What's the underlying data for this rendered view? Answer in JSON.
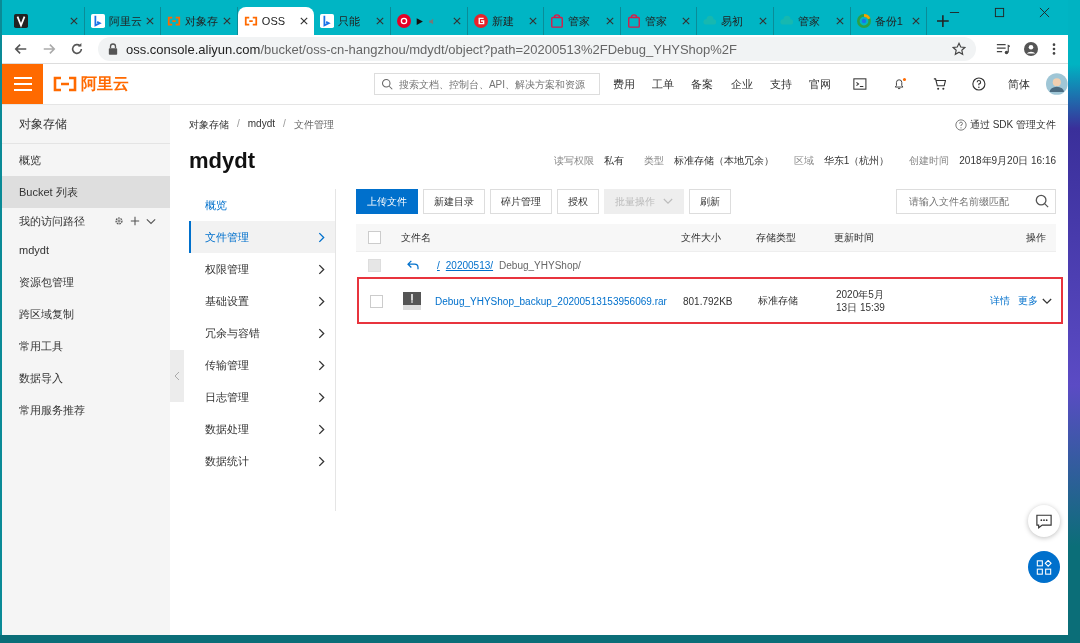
{
  "browser": {
    "tabs": [
      {
        "selected": false
      },
      {
        "title": "阿里云",
        "selected": false
      },
      {
        "title": "对象存",
        "selected": false
      },
      {
        "title": "OSS",
        "selected": true
      },
      {
        "title": "只能",
        "selected": false
      },
      {
        "selected": false
      },
      {
        "title": "新建",
        "selected": false
      },
      {
        "title": "管家",
        "selected": false
      },
      {
        "title": "管家",
        "selected": false
      },
      {
        "title": "易初",
        "selected": false
      },
      {
        "title": "管家",
        "selected": false
      },
      {
        "title": "备份1",
        "selected": false
      }
    ],
    "url": {
      "host": "oss.console.aliyun.com",
      "path": "/bucket/oss-cn-hangzhou/mdydt/object?path=20200513%2FDebug_YHYShop%2F"
    }
  },
  "topnav": {
    "brand": "阿里云",
    "search": {
      "placeholder": "搜索文档、控制台、API、解决方案和资源"
    },
    "links": [
      "费用",
      "工单",
      "备案",
      "企业",
      "支持",
      "官网"
    ],
    "has_notification": true,
    "language": "简体"
  },
  "sidebar": {
    "title": "对象存储",
    "items": [
      {
        "kind": "item",
        "label": "概览",
        "selected": false
      },
      {
        "kind": "item",
        "label": "Bucket 列表",
        "selected": true
      },
      {
        "kind": "section",
        "label": "我的访问路径"
      },
      {
        "kind": "item",
        "label": "mdydt",
        "selected": false
      },
      {
        "kind": "item",
        "label": "资源包管理",
        "selected": false
      },
      {
        "kind": "item",
        "label": "跨区域复制",
        "selected": false
      },
      {
        "kind": "item",
        "label": "常用工具",
        "selected": false
      },
      {
        "kind": "item",
        "label": "数据导入",
        "selected": false
      },
      {
        "kind": "item",
        "label": "常用服务推荐",
        "selected": false
      }
    ]
  },
  "breadcrumb": {
    "items": [
      "对象存储",
      "mdydt",
      "文件管理"
    ],
    "separator": "/"
  },
  "sdk_link": "通过 SDK 管理文件",
  "bucket": {
    "name": "mdydt",
    "meta": [
      {
        "label": "读写权限",
        "value": "私有"
      },
      {
        "label": "类型",
        "value": "标准存储（本地冗余）"
      },
      {
        "label": "区域",
        "value": "华东1（杭州）"
      },
      {
        "label": "创建时间",
        "value": "2018年9月20日 16:16"
      }
    ]
  },
  "subnav": [
    {
      "label": "概览",
      "expandable": false,
      "selected": false
    },
    {
      "label": "文件管理",
      "expandable": true,
      "selected": true
    },
    {
      "label": "权限管理",
      "expandable": true,
      "selected": false
    },
    {
      "label": "基础设置",
      "expandable": true,
      "selected": false
    },
    {
      "label": "冗余与容错",
      "expandable": true,
      "selected": false
    },
    {
      "label": "传输管理",
      "expandable": true,
      "selected": false
    },
    {
      "label": "日志管理",
      "expandable": true,
      "selected": false
    },
    {
      "label": "数据处理",
      "expandable": true,
      "selected": false
    },
    {
      "label": "数据统计",
      "expandable": true,
      "selected": false
    }
  ],
  "toolbar": {
    "buttons": [
      {
        "label": "上传文件",
        "kind": "primary",
        "disabled": false
      },
      {
        "label": "新建目录",
        "kind": "normal",
        "disabled": false
      },
      {
        "label": "碎片管理",
        "kind": "normal",
        "disabled": false
      },
      {
        "label": "授权",
        "kind": "normal",
        "disabled": false
      },
      {
        "label": "批量操作",
        "kind": "dropdown",
        "disabled": true
      },
      {
        "label": "刷新",
        "kind": "normal",
        "disabled": false
      }
    ],
    "search": {
      "placeholder": "请输入文件名前缀匹配"
    }
  },
  "table": {
    "columns": [
      "文件名",
      "文件大小",
      "存储类型",
      "更新时间",
      "操作"
    ],
    "header_checked": false,
    "path": {
      "root": "/",
      "folder": "20200513/",
      "current": "Debug_YHYShop/",
      "checkbox_disabled": true
    },
    "rows": [
      {
        "name": "Debug_YHYShop_backup_20200513153956069.rar",
        "size": "801.792KB",
        "storage": "标准存储",
        "updated": "2020年5月13日 15:39",
        "actions": [
          "详情",
          "更多"
        ],
        "checked": false,
        "highlighted": true
      }
    ]
  }
}
